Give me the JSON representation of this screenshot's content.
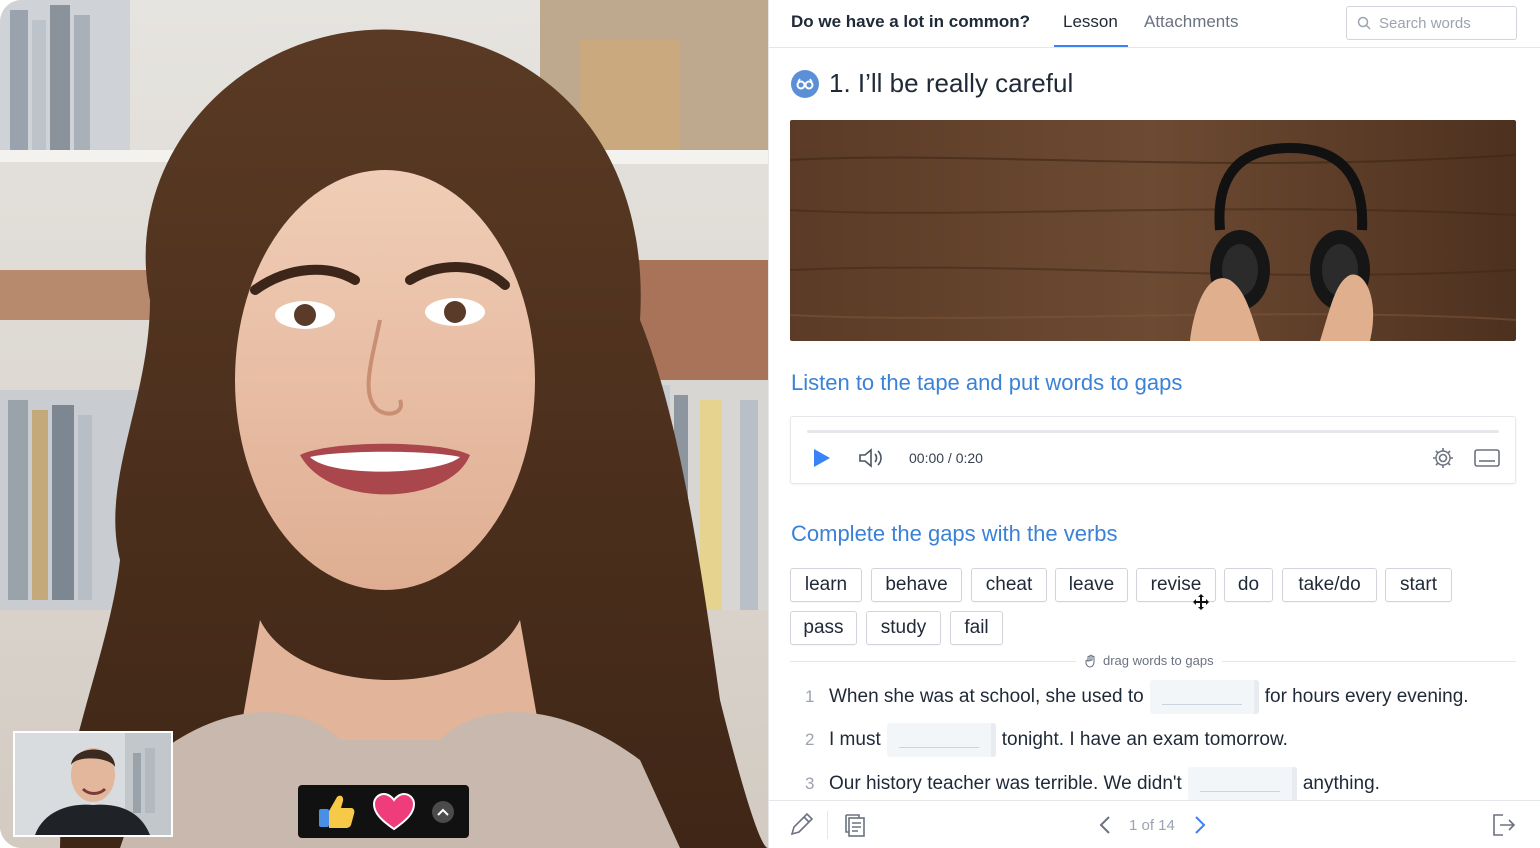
{
  "header": {
    "lesson_title": "Do we have a lot in common?",
    "tabs": [
      {
        "label": "Lesson",
        "active": true
      },
      {
        "label": "Attachments",
        "active": false
      }
    ],
    "search_placeholder": "Search words"
  },
  "section": {
    "title": "1. I’ll be really careful",
    "icon": "glasses-icon"
  },
  "listen_task": {
    "title": "Listen to the tape and put words to gaps",
    "player": {
      "time": "00:00 / 0:20",
      "progress": 0
    }
  },
  "gap_task": {
    "title": "Complete the gaps with the verbs",
    "words": [
      "learn",
      "behave",
      "cheat",
      "leave",
      "revise",
      "do",
      "take/do",
      "start",
      "pass",
      "study",
      "fail"
    ],
    "hint": "drag words to gaps",
    "sentences": [
      {
        "number": "1",
        "before": "When she was at school, she used to",
        "after": "for hours every evening."
      },
      {
        "number": "2",
        "before": "I must",
        "after": "tonight. I have an exam tomorrow."
      },
      {
        "number": "3",
        "before": "Our history teacher was terrible. We didn't",
        "after": "anything."
      }
    ]
  },
  "footer": {
    "pager": "1 of 14"
  },
  "colors": {
    "accent": "#3b82d6",
    "badge": "#5b8fd6",
    "reaction_bar": "#111111"
  }
}
